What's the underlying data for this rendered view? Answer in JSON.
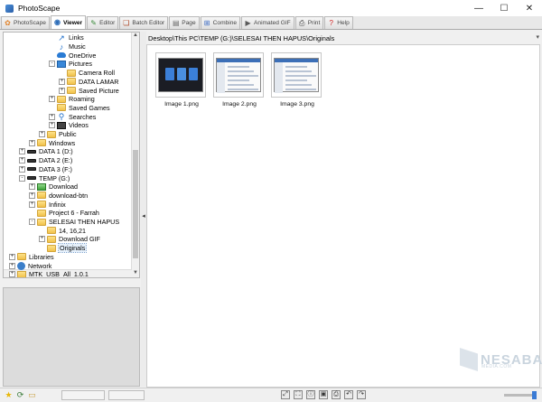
{
  "window": {
    "title": "PhotoScape",
    "controls": {
      "minimize": "—",
      "maximize": "☐",
      "close": "✕"
    }
  },
  "tabs": [
    {
      "label": "PhotoScape",
      "icon": "photoscape-icon",
      "active": false
    },
    {
      "label": "Viewer",
      "icon": "viewer-icon",
      "active": true
    },
    {
      "label": "Editor",
      "icon": "editor-icon",
      "active": false
    },
    {
      "label": "Batch Editor",
      "icon": "batch-editor-icon",
      "active": false
    },
    {
      "label": "Page",
      "icon": "page-icon",
      "active": false
    },
    {
      "label": "Combine",
      "icon": "combine-icon",
      "active": false
    },
    {
      "label": "Animated GIF",
      "icon": "animated-gif-icon",
      "active": false
    },
    {
      "label": "Print",
      "icon": "print-icon",
      "active": false
    },
    {
      "label": "Help",
      "icon": "help-icon",
      "active": false
    }
  ],
  "tree": [
    {
      "label": "Links",
      "icon": "link",
      "level": 4,
      "expander": ""
    },
    {
      "label": "Music",
      "icon": "music",
      "level": 4,
      "expander": ""
    },
    {
      "label": "OneDrive",
      "icon": "cloud",
      "level": 4,
      "expander": ""
    },
    {
      "label": "Pictures",
      "icon": "pics",
      "level": 4,
      "expander": "-"
    },
    {
      "label": "Camera Roll",
      "icon": "folder",
      "level": 5,
      "expander": ""
    },
    {
      "label": "DATA LAMAR",
      "icon": "folder",
      "level": 5,
      "expander": "+"
    },
    {
      "label": "Saved Picture",
      "icon": "folder",
      "level": 5,
      "expander": "+"
    },
    {
      "label": "Roaming",
      "icon": "folder",
      "level": 4,
      "expander": "+"
    },
    {
      "label": "Saved Games",
      "icon": "folder",
      "level": 4,
      "expander": ""
    },
    {
      "label": "Searches",
      "icon": "search",
      "level": 4,
      "expander": "+"
    },
    {
      "label": "Videos",
      "icon": "video",
      "level": 4,
      "expander": "+"
    },
    {
      "label": "Public",
      "icon": "folder",
      "level": 3,
      "expander": "+"
    },
    {
      "label": "Windows",
      "icon": "folder",
      "level": 2,
      "expander": "+"
    },
    {
      "label": "DATA 1 (D:)",
      "icon": "drive",
      "level": 1,
      "expander": "+"
    },
    {
      "label": "DATA 2 (E:)",
      "icon": "drive",
      "level": 1,
      "expander": "+"
    },
    {
      "label": "DATA 3 (F:)",
      "icon": "drive",
      "level": 1,
      "expander": "+"
    },
    {
      "label": "TEMP (G:)",
      "icon": "drive",
      "level": 1,
      "expander": "-"
    },
    {
      "label": "Download",
      "icon": "down",
      "level": 2,
      "expander": "+"
    },
    {
      "label": "download-btn",
      "icon": "folder",
      "level": 2,
      "expander": "+"
    },
    {
      "label": "Infinix",
      "icon": "folder",
      "level": 2,
      "expander": "+"
    },
    {
      "label": "Project 6 - Farrah",
      "icon": "folder",
      "level": 2,
      "expander": ""
    },
    {
      "label": "SELESAI THEN HAPUS",
      "icon": "folder",
      "level": 2,
      "expander": "-"
    },
    {
      "label": "14, 16,21",
      "icon": "folder",
      "level": 3,
      "expander": ""
    },
    {
      "label": "Download GIF",
      "icon": "folder",
      "level": 3,
      "expander": "+"
    },
    {
      "label": "Originals",
      "icon": "folder",
      "level": 3,
      "expander": "",
      "selected": true
    },
    {
      "label": "Libraries",
      "icon": "folder",
      "level": 0,
      "expander": "+"
    },
    {
      "label": "Network",
      "icon": "net",
      "level": 0,
      "expander": "+"
    },
    {
      "label": "MTK_USB_All_1.0.1",
      "icon": "usb",
      "level": 0,
      "expander": "+"
    }
  ],
  "path": "Desktop\\This PC\\TEMP (G:)\\SELESAI THEN HAPUS\\Originals",
  "thumbnails": [
    {
      "name": "Image 1.png",
      "style": "dark"
    },
    {
      "name": "Image 2.png",
      "style": "light"
    },
    {
      "name": "Image 3.png",
      "style": "light"
    }
  ],
  "watermark": {
    "name": "NESABA",
    "sub": "MEDIA.COM"
  },
  "status": {
    "left_icons": [
      "star-icon",
      "rotate-icon",
      "folder-open-icon"
    ],
    "tools": [
      "fit-icon",
      "fullscreen-icon",
      "info-icon",
      "save-icon",
      "print-small-icon",
      "undo-icon",
      "redo-icon"
    ],
    "tool_glyphs": [
      "⤢",
      "⛶",
      "ⓘ",
      "▣",
      "⎙",
      "↶",
      "↷"
    ],
    "zoom_level": 1.0
  }
}
